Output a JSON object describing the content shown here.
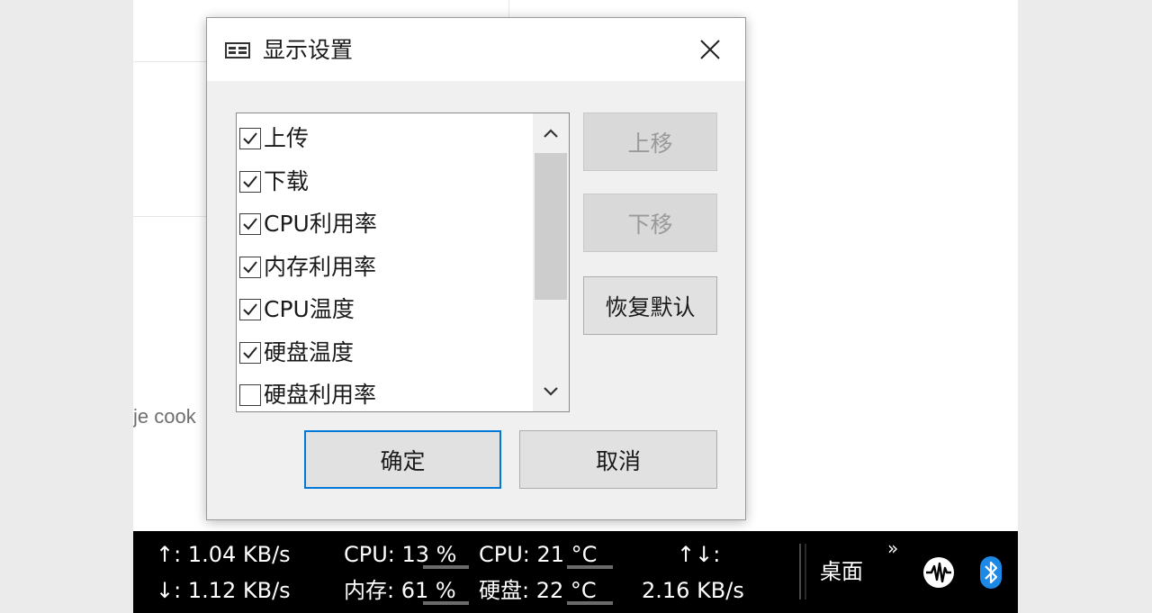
{
  "background": {
    "partial_text": "je cook"
  },
  "dialog": {
    "title": "显示设置",
    "items": [
      {
        "label": "上传",
        "checked": true
      },
      {
        "label": "下载",
        "checked": true
      },
      {
        "label": "CPU利用率",
        "checked": true
      },
      {
        "label": "内存利用率",
        "checked": true
      },
      {
        "label": "CPU温度",
        "checked": true
      },
      {
        "label": "硬盘温度",
        "checked": true
      },
      {
        "label": "硬盘利用率",
        "checked": false
      }
    ],
    "buttons": {
      "move_up": "上移",
      "move_down": "下移",
      "restore_default": "恢复默认",
      "ok": "确定",
      "cancel": "取消"
    }
  },
  "taskbar": {
    "upload": "↑: 1.04 KB/s",
    "download": "↓: 1.12 KB/s",
    "cpu_usage": "CPU: 13 %",
    "memory_usage": "内存: 61 %",
    "cpu_temp": "CPU: 21 °C",
    "disk_temp": "硬盘: 22 °C",
    "total_label": "↑↓:",
    "total_value": "2.16 KB/s",
    "desktop": "桌面",
    "overflow_glyph": "»"
  },
  "colors": {
    "accent": "#0078d7",
    "bluetooth": "#1e88e5",
    "taskbar_bg": "#000000"
  }
}
